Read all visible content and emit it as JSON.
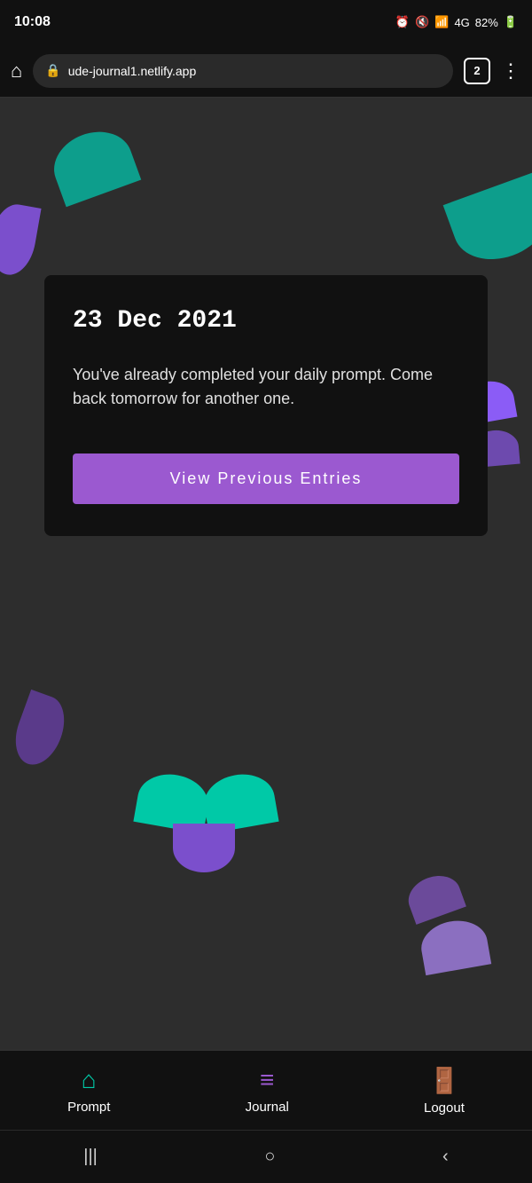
{
  "statusBar": {
    "time": "10:08",
    "batteryPct": "82%",
    "tabCount": "2"
  },
  "browserBar": {
    "url": "ude-journal1.netlify.app"
  },
  "card": {
    "date": "23 Dec 2021",
    "message": "You've already completed your daily prompt. Come back tomorrow for another one.",
    "buttonLabel": "View Previous Entries"
  },
  "bottomNav": {
    "items": [
      {
        "id": "prompt",
        "label": "Prompt",
        "icon": "🏠",
        "iconColor": "teal"
      },
      {
        "id": "journal",
        "label": "Journal",
        "icon": "📋",
        "iconColor": "purple"
      },
      {
        "id": "logout",
        "label": "Logout",
        "icon": "🚪",
        "iconColor": "teal"
      }
    ]
  },
  "androidNav": {
    "back": "‹",
    "home": "○",
    "recent": "|||"
  }
}
